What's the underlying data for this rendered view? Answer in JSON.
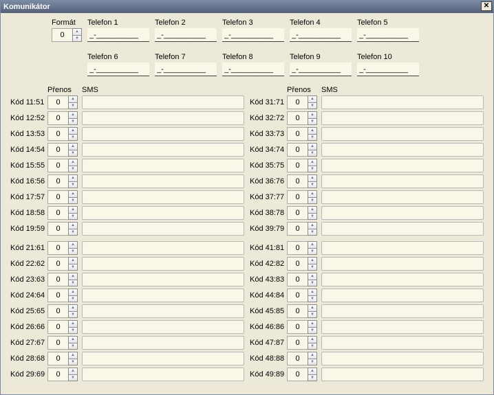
{
  "window": {
    "title": "Komunikátor"
  },
  "labels": {
    "format": "Formát",
    "prenos": "Přenos",
    "sms": "SMS"
  },
  "format": {
    "value": "0"
  },
  "phones": [
    {
      "label": "Telefon 1",
      "value": "_-__________"
    },
    {
      "label": "Telefon 2",
      "value": "_-__________"
    },
    {
      "label": "Telefon 3",
      "value": "_-__________"
    },
    {
      "label": "Telefon 4",
      "value": "_-__________"
    },
    {
      "label": "Telefon 5",
      "value": "_-__________"
    },
    {
      "label": "Telefon 6",
      "value": "_-__________"
    },
    {
      "label": "Telefon 7",
      "value": "_-__________"
    },
    {
      "label": "Telefon 8",
      "value": "_-__________"
    },
    {
      "label": "Telefon 9",
      "value": "_-__________"
    },
    {
      "label": "Telefon 10",
      "value": "_-__________"
    }
  ],
  "left": [
    [
      {
        "label": "Kód 11:51",
        "prenos": "0",
        "sms": ""
      },
      {
        "label": "Kód 12:52",
        "prenos": "0",
        "sms": ""
      },
      {
        "label": "Kód 13:53",
        "prenos": "0",
        "sms": ""
      },
      {
        "label": "Kód 14:54",
        "prenos": "0",
        "sms": ""
      },
      {
        "label": "Kód 15:55",
        "prenos": "0",
        "sms": ""
      },
      {
        "label": "Kód 16:56",
        "prenos": "0",
        "sms": ""
      },
      {
        "label": "Kód 17:57",
        "prenos": "0",
        "sms": ""
      },
      {
        "label": "Kód 18:58",
        "prenos": "0",
        "sms": ""
      },
      {
        "label": "Kód 19:59",
        "prenos": "0",
        "sms": ""
      }
    ],
    [
      {
        "label": "Kód 21:61",
        "prenos": "0",
        "sms": ""
      },
      {
        "label": "Kód 22:62",
        "prenos": "0",
        "sms": ""
      },
      {
        "label": "Kód 23:63",
        "prenos": "0",
        "sms": ""
      },
      {
        "label": "Kód 24:64",
        "prenos": "0",
        "sms": ""
      },
      {
        "label": "Kód 25:65",
        "prenos": "0",
        "sms": ""
      },
      {
        "label": "Kód 26:66",
        "prenos": "0",
        "sms": ""
      },
      {
        "label": "Kód 27:67",
        "prenos": "0",
        "sms": ""
      },
      {
        "label": "Kód 28:68",
        "prenos": "0",
        "sms": ""
      },
      {
        "label": "Kód 29:69",
        "prenos": "0",
        "sms": ""
      }
    ]
  ],
  "right": [
    [
      {
        "label": "Kód 31:71",
        "prenos": "0",
        "sms": ""
      },
      {
        "label": "Kód 32:72",
        "prenos": "0",
        "sms": ""
      },
      {
        "label": "Kód 33:73",
        "prenos": "0",
        "sms": ""
      },
      {
        "label": "Kód 34:74",
        "prenos": "0",
        "sms": ""
      },
      {
        "label": "Kód 35:75",
        "prenos": "0",
        "sms": ""
      },
      {
        "label": "Kód 36:76",
        "prenos": "0",
        "sms": ""
      },
      {
        "label": "Kód 37:77",
        "prenos": "0",
        "sms": ""
      },
      {
        "label": "Kód 38:78",
        "prenos": "0",
        "sms": ""
      },
      {
        "label": "Kód 39:79",
        "prenos": "0",
        "sms": ""
      }
    ],
    [
      {
        "label": "Kód 41:81",
        "prenos": "0",
        "sms": ""
      },
      {
        "label": "Kód 42:82",
        "prenos": "0",
        "sms": ""
      },
      {
        "label": "Kód 43:83",
        "prenos": "0",
        "sms": ""
      },
      {
        "label": "Kód 44:84",
        "prenos": "0",
        "sms": ""
      },
      {
        "label": "Kód 45:85",
        "prenos": "0",
        "sms": ""
      },
      {
        "label": "Kód 46:86",
        "prenos": "0",
        "sms": ""
      },
      {
        "label": "Kód 47:87",
        "prenos": "0",
        "sms": ""
      },
      {
        "label": "Kód 48:88",
        "prenos": "0",
        "sms": ""
      },
      {
        "label": "Kód 49:89",
        "prenos": "0",
        "sms": ""
      }
    ]
  ]
}
